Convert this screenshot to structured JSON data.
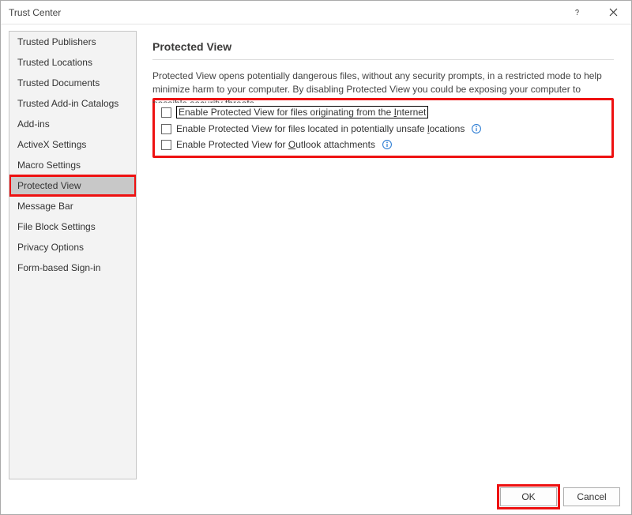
{
  "window": {
    "title": "Trust Center"
  },
  "sidebar": {
    "items": [
      {
        "label": "Trusted Publishers"
      },
      {
        "label": "Trusted Locations"
      },
      {
        "label": "Trusted Documents"
      },
      {
        "label": "Trusted Add-in Catalogs"
      },
      {
        "label": "Add-ins"
      },
      {
        "label": "ActiveX Settings"
      },
      {
        "label": "Macro Settings"
      },
      {
        "label": "Protected View",
        "selected": true
      },
      {
        "label": "Message Bar"
      },
      {
        "label": "File Block Settings"
      },
      {
        "label": "Privacy Options"
      },
      {
        "label": "Form-based Sign-in"
      }
    ]
  },
  "content": {
    "header": "Protected View",
    "description": "Protected View opens potentially dangerous files, without any security prompts, in a restricted mode to help minimize harm to your computer. By disabling Protected View you could be exposing your computer to possible security threats.",
    "options": [
      {
        "label_pre": "Enable Protected View for files originating from the ",
        "mnemonic": "I",
        "label_post": "nternet",
        "checked": false,
        "info": false,
        "focused": true
      },
      {
        "label_pre": "Enable Protected View for files located in potentially unsafe ",
        "mnemonic": "l",
        "label_post": "ocations",
        "checked": false,
        "info": true,
        "focused": false
      },
      {
        "label_pre": "Enable Protected View for ",
        "mnemonic": "O",
        "label_post": "utlook attachments",
        "checked": false,
        "info": true,
        "focused": false
      }
    ]
  },
  "footer": {
    "ok": "OK",
    "cancel": "Cancel"
  }
}
